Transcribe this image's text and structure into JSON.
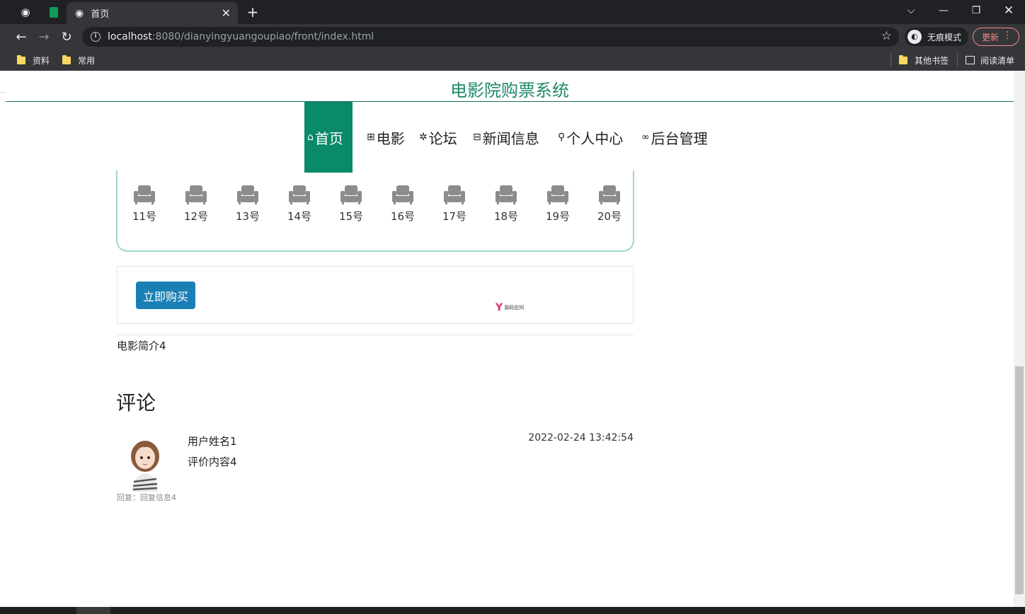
{
  "browser": {
    "active_tab_title": "首页",
    "url_host": "localhost",
    "url_path": ":8080/dianyingyuangoupiao/front/index.html",
    "incognito_label": "无痕模式",
    "update_label": "更新",
    "bookmarks": [
      "资料",
      "常用"
    ],
    "other_bookmarks": "其他书签",
    "reading_list": "阅读清单"
  },
  "site": {
    "title": "电影院购票系统",
    "nav": [
      {
        "label": "首页",
        "icon": "home-icon"
      },
      {
        "label": "电影",
        "icon": "gift-icon"
      },
      {
        "label": "论坛",
        "icon": "gear-icon"
      },
      {
        "label": "新闻信息",
        "icon": "book-icon"
      },
      {
        "label": "个人中心",
        "icon": "user-icon"
      },
      {
        "label": "后台管理",
        "icon": "link-icon"
      }
    ]
  },
  "seats": [
    "11号",
    "12号",
    "13号",
    "14号",
    "15号",
    "16号",
    "17号",
    "18号",
    "19号",
    "20号"
  ],
  "buy_button": "立即购买",
  "logo_text": "源码空间",
  "intro": "电影简介4",
  "comments": {
    "title": "评论",
    "items": [
      {
        "user": "用户姓名1",
        "content": "评价内容4",
        "time": "2022-02-24 13:42:54",
        "reply": "回复：回复信息4"
      }
    ]
  },
  "colors": {
    "brand": "#1d8a6c",
    "nav_active": "#0a8a68",
    "button": "#1a7fb5",
    "seat": "#8c8c8c"
  }
}
